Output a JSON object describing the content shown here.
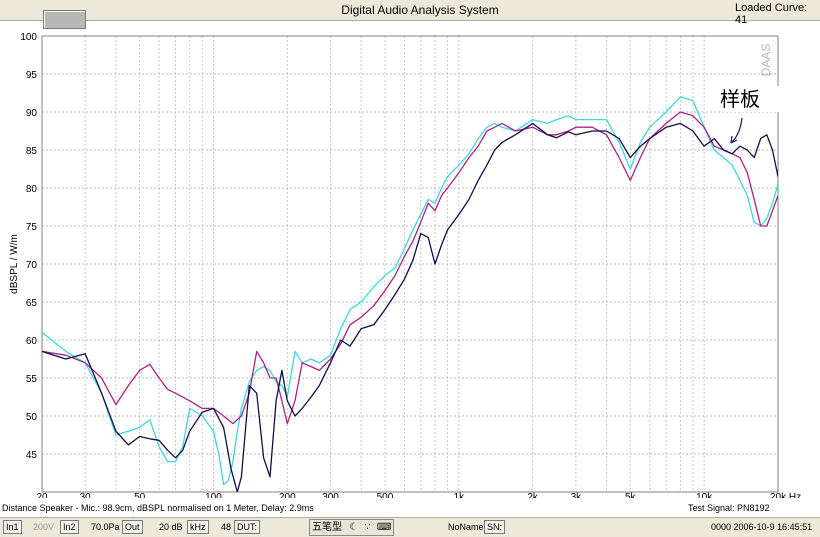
{
  "window": {
    "title": "Digital Audio Analysis System",
    "loaded_curve": "Loaded Curve: 41"
  },
  "annotation": "样板",
  "watermark": "DAAS",
  "chart_data": {
    "type": "line",
    "title": "",
    "xlabel": "",
    "ylabel": "dBSPL / W/m",
    "x_scale": "log",
    "xlim": [
      20,
      20000
    ],
    "ylim": [
      40,
      100
    ],
    "x_ticks": [
      20,
      30,
      50,
      100,
      200,
      300,
      500,
      1000,
      2000,
      3000,
      5000,
      10000,
      20000
    ],
    "x_tick_labels": [
      "20",
      "30",
      "50",
      "100",
      "200",
      "300",
      "500",
      "1k",
      "2k",
      "3k",
      "5k",
      "10k",
      "20k Hz"
    ],
    "y_ticks": [
      40,
      45,
      50,
      55,
      60,
      65,
      70,
      75,
      80,
      85,
      90,
      95,
      100
    ],
    "y_tick_labels": [
      "40",
      "45",
      "50",
      "55",
      "60",
      "65",
      "70",
      "75",
      "80",
      "85",
      "90",
      "95",
      "100"
    ],
    "grid": true,
    "series": [
      {
        "color": "#0f0f4a",
        "x": [
          20,
          25,
          30,
          35,
          40,
          45,
          50,
          55,
          60,
          65,
          70,
          75,
          80,
          90,
          100,
          110,
          118,
          125,
          130,
          140,
          150,
          160,
          170,
          180,
          190,
          200,
          215,
          230,
          250,
          270,
          300,
          330,
          360,
          400,
          450,
          500,
          550,
          600,
          650,
          700,
          750,
          800,
          850,
          900,
          1000,
          1100,
          1200,
          1300,
          1400,
          1500,
          1700,
          2000,
          2300,
          2500,
          2800,
          3000,
          3500,
          4000,
          4500,
          5000,
          5500,
          6000,
          7000,
          8000,
          9000,
          10000,
          11000,
          12000,
          13000,
          14000,
          15000,
          16000,
          17000,
          18000,
          19000,
          20000
        ],
        "y": [
          58.5,
          57.5,
          58.2,
          53.0,
          48.0,
          46.2,
          47.3,
          47.0,
          46.8,
          45.5,
          44.5,
          45.5,
          48.0,
          50.5,
          51.0,
          48.5,
          43.0,
          40.0,
          42.0,
          54.0,
          53.0,
          44.5,
          42.0,
          52.0,
          56.0,
          52.0,
          50.0,
          51.0,
          52.5,
          54.0,
          57.0,
          60.0,
          59.2,
          61.5,
          62.0,
          64.0,
          66.0,
          68.0,
          70.5,
          74.0,
          73.5,
          70.0,
          72.5,
          74.5,
          76.5,
          78.5,
          81.0,
          83.0,
          85.0,
          86.0,
          87.0,
          88.5,
          87.0,
          86.6,
          87.4,
          87.0,
          87.5,
          87.5,
          86.5,
          84.0,
          85.5,
          86.5,
          88.0,
          88.5,
          87.5,
          85.5,
          86.5,
          85.0,
          84.5,
          85.5,
          85.0,
          84.0,
          86.5,
          87.0,
          85.0,
          81.5
        ]
      },
      {
        "color": "#aa2288",
        "x": [
          20,
          25,
          30,
          35,
          40,
          45,
          50,
          55,
          60,
          65,
          70,
          80,
          90,
          100,
          110,
          120,
          130,
          140,
          150,
          160,
          170,
          180,
          190,
          200,
          215,
          230,
          250,
          270,
          300,
          330,
          360,
          400,
          450,
          500,
          550,
          600,
          650,
          700,
          750,
          800,
          850,
          900,
          1000,
          1100,
          1200,
          1300,
          1400,
          1500,
          1700,
          2000,
          2300,
          2500,
          2800,
          3000,
          3500,
          4000,
          4500,
          5000,
          5500,
          6000,
          7000,
          8000,
          9000,
          10000,
          11000,
          12000,
          13000,
          14000,
          15000,
          16000,
          17000,
          18000,
          19000,
          20000
        ],
        "y": [
          58.5,
          58.0,
          57.0,
          55.0,
          51.5,
          54.0,
          56.0,
          56.8,
          55.0,
          53.5,
          53.0,
          52.0,
          51.0,
          51.0,
          50.0,
          49.0,
          50.0,
          53.0,
          58.5,
          57.0,
          55.0,
          55.0,
          52.0,
          49.0,
          52.0,
          57.0,
          56.5,
          56.0,
          57.5,
          59.5,
          62.0,
          63.0,
          64.5,
          66.5,
          68.5,
          71.0,
          73.0,
          75.5,
          78.0,
          77.0,
          79.0,
          80.0,
          82.0,
          84.0,
          85.5,
          87.5,
          88.0,
          88.5,
          87.5,
          88.0,
          87.0,
          87.0,
          87.5,
          88.0,
          88.0,
          87.0,
          84.0,
          81.0,
          84.0,
          86.5,
          88.5,
          90.0,
          89.5,
          88.0,
          85.5,
          85.0,
          84.5,
          84.0,
          82.0,
          78.5,
          75.0,
          75.0,
          77.0,
          79.0
        ]
      },
      {
        "color": "#40d8d8",
        "x": [
          20,
          25,
          30,
          35,
          40,
          45,
          50,
          55,
          60,
          65,
          70,
          75,
          80,
          90,
          100,
          105,
          110,
          115,
          120,
          125,
          130,
          140,
          150,
          160,
          170,
          180,
          190,
          200,
          215,
          230,
          250,
          270,
          300,
          330,
          360,
          400,
          450,
          500,
          550,
          600,
          650,
          700,
          750,
          800,
          850,
          900,
          1000,
          1100,
          1200,
          1300,
          1400,
          1500,
          1700,
          2000,
          2300,
          2500,
          2800,
          3000,
          3500,
          4000,
          4500,
          5000,
          5500,
          6000,
          7000,
          8000,
          9000,
          10000,
          11000,
          12000,
          13000,
          14000,
          15000,
          16000,
          17000,
          18000,
          19000,
          20000
        ],
        "y": [
          61.0,
          58.5,
          57.0,
          53.0,
          47.5,
          48.0,
          48.5,
          49.5,
          46.0,
          44.0,
          44.0,
          46.0,
          51.0,
          50.0,
          48.0,
          45.0,
          41.0,
          41.5,
          44.0,
          48.0,
          51.0,
          54.5,
          56.0,
          56.5,
          56.0,
          54.5,
          54.0,
          52.5,
          58.5,
          57.0,
          57.5,
          57.0,
          58.0,
          61.5,
          64.0,
          65.0,
          67.0,
          68.5,
          69.5,
          72.0,
          74.5,
          76.5,
          78.5,
          78.0,
          80.0,
          81.5,
          83.0,
          84.5,
          86.5,
          88.0,
          88.5,
          88.0,
          87.5,
          89.0,
          88.5,
          89.0,
          89.5,
          89.0,
          89.0,
          89.0,
          86.0,
          82.5,
          86.0,
          88.0,
          90.0,
          92.0,
          91.5,
          88.0,
          85.0,
          84.0,
          83.0,
          81.0,
          79.0,
          75.5,
          75.0,
          76.0,
          78.0,
          80.5
        ]
      }
    ]
  },
  "status": {
    "info_left": "Distance Speaker - Mic.: 98.9cm, dBSPL normalised on 1 Meter, Delay: 2.9ms",
    "info_right": "Test Signal: PN8192",
    "in1": "In1",
    "v200": "200V",
    "in2": "In2",
    "pa": "70.0Pa",
    "out": "Out",
    "db": "20 dB",
    "khz": "kHz",
    "n48": "48",
    "dut": "DUT:",
    "ime": "五笔型",
    "noname": "NoName",
    "sn": "SN:",
    "date": "0000  2006-10-9  16:45:51"
  },
  "colors": {
    "grid": "#b8b8b8",
    "grid_minor": "#c8c8c8",
    "plot_bg": "#ffffff"
  }
}
